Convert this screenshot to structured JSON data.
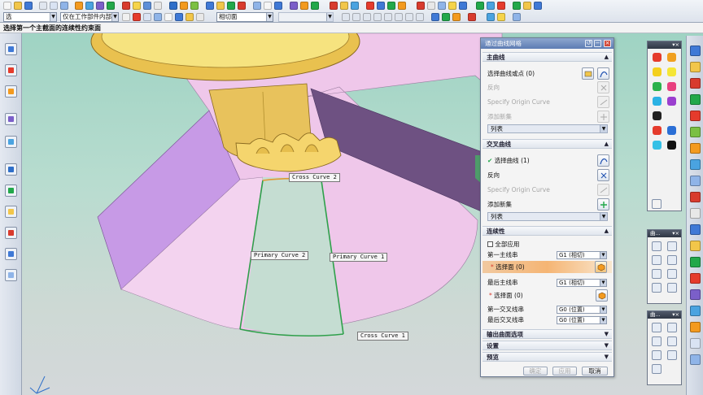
{
  "toolbar": {
    "filter_select": "选",
    "scope_select": "仅在工作部件内部",
    "snap_select": "相切面",
    "colors": {
      "accent_blue": "#3f79d6",
      "accent_green": "#22a84a",
      "accent_orange": "#f39a1f",
      "accent_red": "#d83b2e"
    }
  },
  "status": {
    "prompt": "选择第一个主截面的连续性约束面"
  },
  "viewport": {
    "labels": {
      "cross_curve_2": "Cross Curve  2",
      "cross_curve_1": "Cross Curve  1",
      "primary_curve_2": "Primary Curve  2",
      "primary_curve_1": "Primary Curve  1"
    },
    "colors": {
      "background_top": "#9fd3c3",
      "surface_pink": "#efc7ea",
      "surface_purple": "#c79ae6",
      "surface_dark": "#6e5182",
      "part_gold": "#f2d26a",
      "curve_green": "#2fa04b"
    }
  },
  "dialog": {
    "title": "通过曲线网格",
    "sections": {
      "primary": {
        "header": "主曲线",
        "select_label": "选择曲线或点 (0)",
        "reverse_label": "反向",
        "specify_origin_label": "Specify Origin Curve",
        "add_set_label": "添加新集",
        "list_label": "列表"
      },
      "cross": {
        "header": "交叉曲线",
        "select_label": "选择曲线 (1)",
        "reverse_label": "反向",
        "specify_origin_label": "Specify Origin Curve",
        "add_set_label": "添加新集",
        "list_label": "列表"
      },
      "continuity": {
        "header": "连续性",
        "apply_all_label": "全部应用",
        "first_primary_label": "第一主线串",
        "first_primary_value": "G1 (相切)",
        "select_face_highlight": "选择面 (0)",
        "last_primary_label": "最后主线串",
        "last_primary_value": "G1 (相切)",
        "select_face_label": "选择面 (0)",
        "first_cross_label": "第一交叉线串",
        "first_cross_value": "G0 (位置)",
        "last_cross_label": "最后交叉线串",
        "last_cross_value": "G0 (位置)"
      },
      "output_options": {
        "header": "输出曲面选项"
      },
      "settings": {
        "header": "设置"
      },
      "preview": {
        "header": "预览"
      }
    },
    "buttons": {
      "ok": "确定",
      "apply": "应用",
      "cancel": "取消"
    }
  },
  "palettes": {
    "color_palette": {
      "title": "",
      "swatches": [
        "#e53b2c",
        "#f0a020",
        "#f4d01e",
        "#f5e636",
        "#2bb24c",
        "#e8407f",
        "#2bb2e4",
        "#9b3fcf",
        "#222222",
        "#f2f2f2",
        "#e53b2c",
        "#2b6fd6",
        "#34c0e6",
        "#111111"
      ]
    },
    "curve_palette": {
      "title": "曲..."
    },
    "edit_palette": {
      "title": "曲..."
    }
  }
}
